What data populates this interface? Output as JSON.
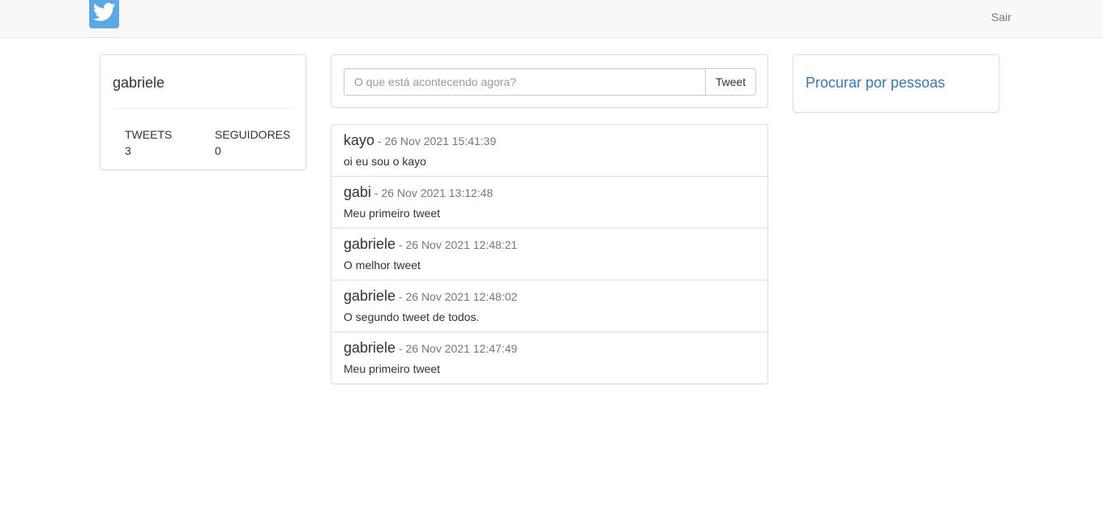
{
  "navbar": {
    "logo_icon": "twitter-bird-icon",
    "logout_label": "Sair"
  },
  "profile": {
    "username": "gabriele",
    "tweets_label": "TWEETS",
    "tweets_count": "3",
    "followers_label": "SEGUIDORES",
    "followers_count": "0"
  },
  "compose": {
    "placeholder": "O que está acontecendo agora?",
    "value": "",
    "button_label": "Tweet"
  },
  "feed": {
    "tweets": [
      {
        "author": "kayo",
        "date": " - 26 Nov 2021 15:41:39",
        "text": "oi eu sou o kayo"
      },
      {
        "author": "gabi",
        "date": " - 26 Nov 2021 13:12:48",
        "text": "Meu primeiro tweet"
      },
      {
        "author": "gabriele",
        "date": " - 26 Nov 2021 12:48:21",
        "text": "O melhor tweet"
      },
      {
        "author": "gabriele",
        "date": " - 26 Nov 2021 12:48:02",
        "text": "O segundo tweet de todos."
      },
      {
        "author": "gabriele",
        "date": " - 26 Nov 2021 12:47:49",
        "text": "Meu primeiro tweet"
      }
    ]
  },
  "search_people": {
    "link_label": "Procurar por pessoas"
  },
  "colors": {
    "navbar_bg": "#f8f8f8",
    "logo_blue": "#5aa9e6",
    "link_blue": "#337ab7",
    "border": "#dddddd"
  }
}
